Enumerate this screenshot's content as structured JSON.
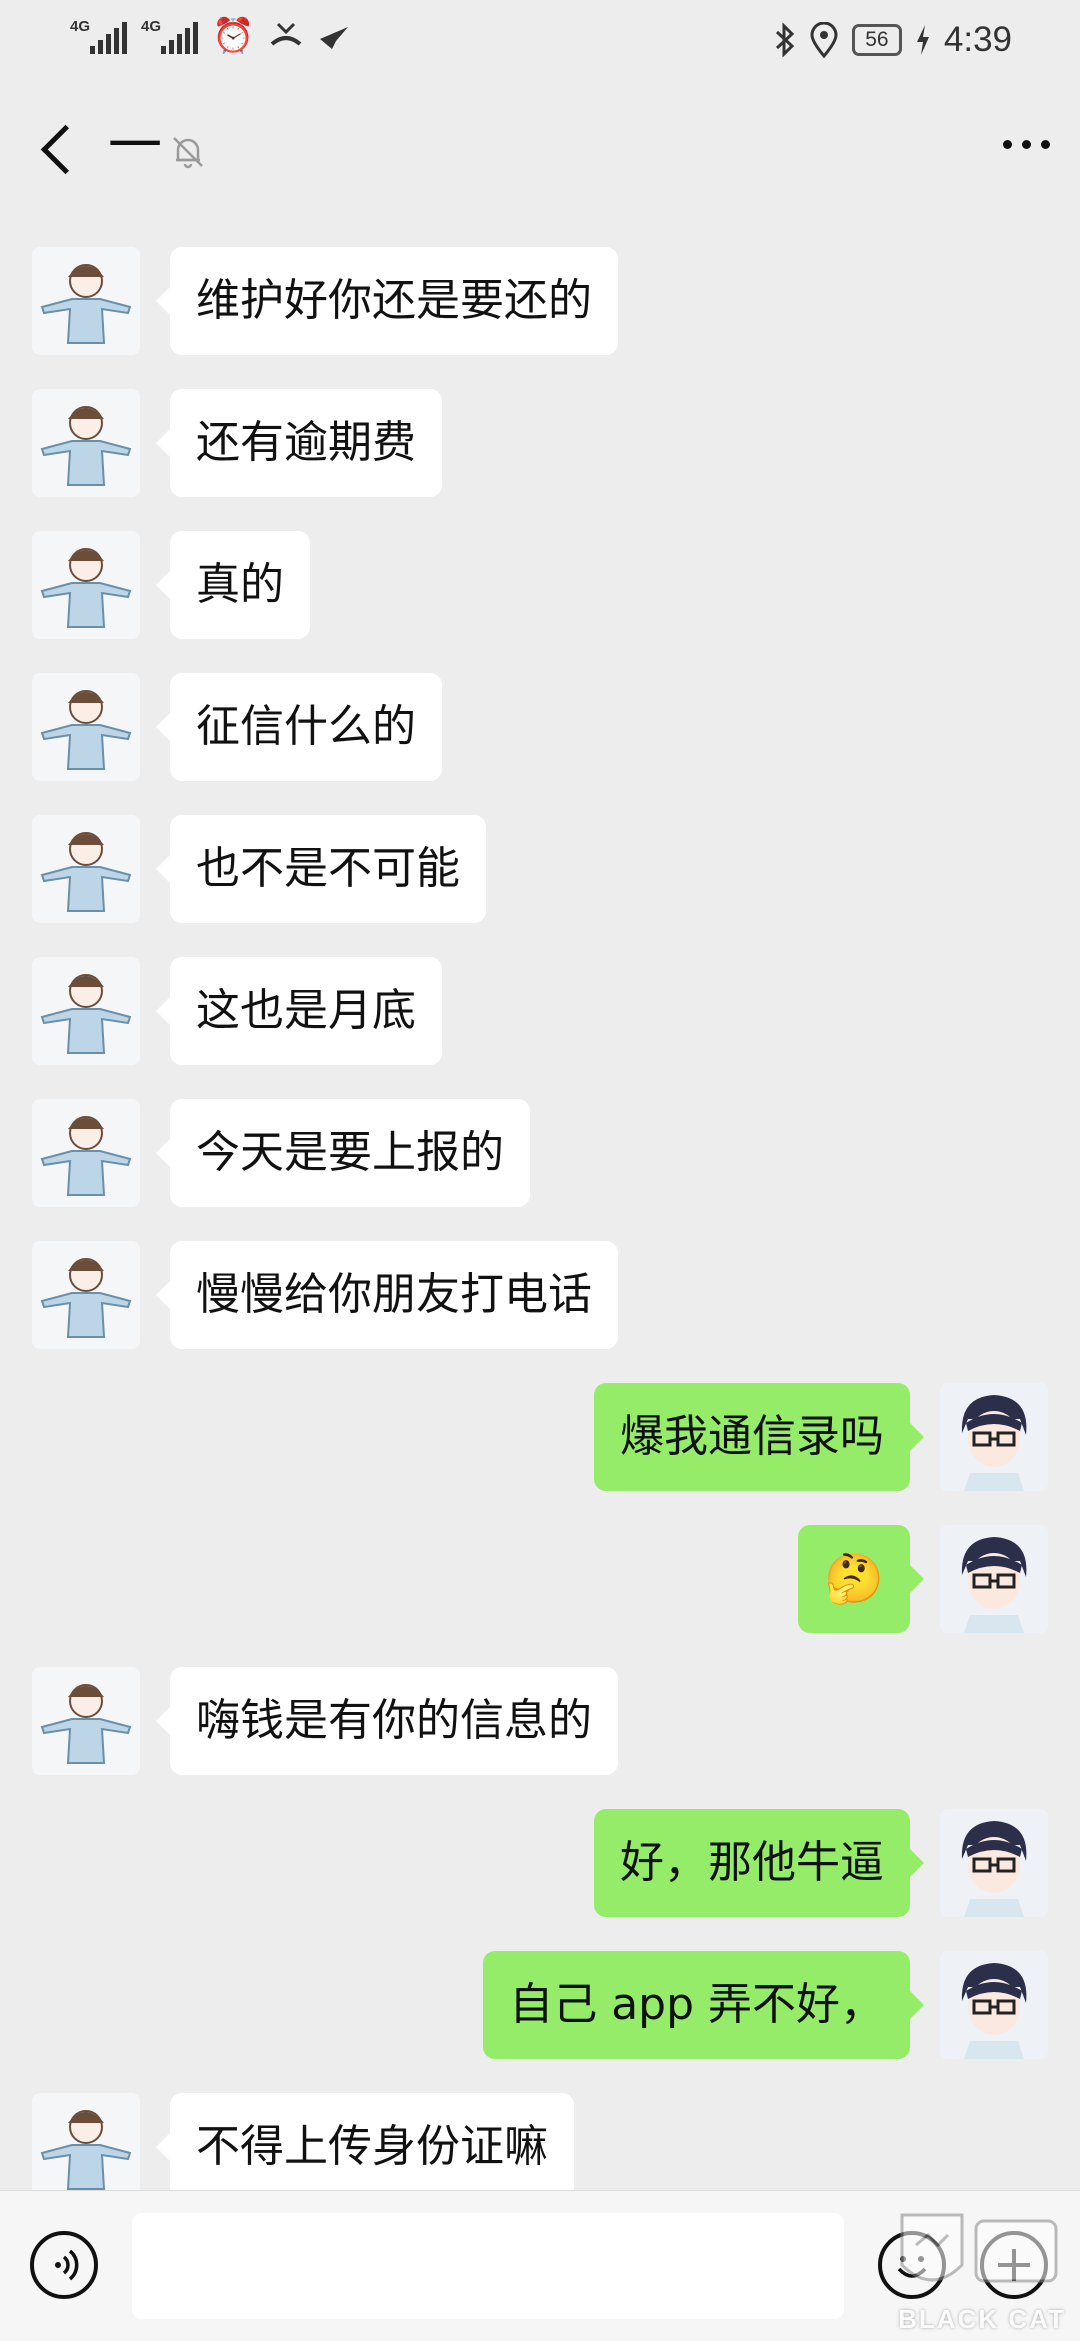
{
  "status_bar": {
    "network1": "4G",
    "network2": "4G",
    "battery": "56",
    "time": "4:39"
  },
  "header": {
    "title": "一"
  },
  "messages": [
    {
      "side": "left",
      "text": "维护好你还是要还的"
    },
    {
      "side": "left",
      "text": "还有逾期费"
    },
    {
      "side": "left",
      "text": "真的"
    },
    {
      "side": "left",
      "text": "征信什么的"
    },
    {
      "side": "left",
      "text": "也不是不可能"
    },
    {
      "side": "left",
      "text": "这也是月底"
    },
    {
      "side": "left",
      "text": "今天是要上报的"
    },
    {
      "side": "left",
      "text": "慢慢给你朋友打电话"
    },
    {
      "side": "right",
      "text": "爆我通信录吗"
    },
    {
      "side": "right",
      "text": "🤔",
      "icon": "thinking-face-emoji"
    },
    {
      "side": "left",
      "text": "嗨钱是有你的信息的"
    },
    {
      "side": "right",
      "text": "好，那他牛逼"
    },
    {
      "side": "right",
      "text": "自己 app 弄不好，"
    },
    {
      "side": "left",
      "text": "不得上传身份证嘛"
    }
  ],
  "input_bar": {
    "value": "",
    "voice_icon": "voice-icon",
    "emoji_icon": "emoji-icon",
    "plus_icon": "plus-icon"
  },
  "watermark": {
    "text": "BLACK CAT"
  },
  "colors": {
    "background": "#ededed",
    "incoming_bubble": "#ffffff",
    "outgoing_bubble": "#95ec69"
  }
}
